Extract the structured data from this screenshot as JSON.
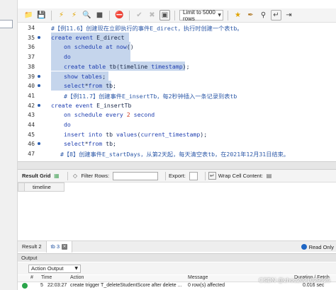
{
  "toolbar": {
    "limit_select": "Limit to 5000 rows",
    "icons": [
      "folder-icon",
      "save-icon",
      "bolt-icon",
      "bolt-cursor-icon",
      "magnify-icon",
      "stop-icon",
      "refresh-icon",
      "no-entry-icon",
      "check-circle-icon",
      "cancel-circle-icon",
      "toggle-output-icon",
      "star-icon",
      "brush-icon",
      "search-icon",
      "wrap-icon",
      "indent-icon"
    ]
  },
  "editor": {
    "lines": [
      {
        "num": "34",
        "dot": false,
        "selected": false,
        "indent": 1,
        "text": "#【例11.6】创建现在立即执行的事件E_direct，执行时创建一个表tb。"
      },
      {
        "num": "35",
        "dot": true,
        "selected": true,
        "indent": 1,
        "text": "create event E_direct"
      },
      {
        "num": "36",
        "dot": false,
        "selected": true,
        "indent": 3,
        "text": "on schedule at now()"
      },
      {
        "num": "37",
        "dot": false,
        "selected": true,
        "indent": 3,
        "text": "do"
      },
      {
        "num": "38",
        "dot": false,
        "selected": true,
        "indent": 3,
        "text": "create table tb(timeline timestamp);"
      },
      {
        "num": "39",
        "dot": true,
        "selected": true,
        "indent": 3,
        "text": "show tables;"
      },
      {
        "num": "40",
        "dot": true,
        "selected": true,
        "indent": 3,
        "text": "select*from tb;"
      },
      {
        "num": "41",
        "dot": false,
        "selected": false,
        "indent": 3,
        "text": "#【例11.7】创建事件E_insertTb，每2秒钟插入一条记录到表tb"
      },
      {
        "num": "42",
        "dot": true,
        "selected": false,
        "indent": 1,
        "text": "create event E_insertTb"
      },
      {
        "num": "43",
        "dot": false,
        "selected": false,
        "indent": 3,
        "text": "on schedule every 2 second"
      },
      {
        "num": "44",
        "dot": false,
        "selected": false,
        "indent": 3,
        "text": "do"
      },
      {
        "num": "45",
        "dot": false,
        "selected": false,
        "indent": 3,
        "text": "insert into tb values(current_timestamp);"
      },
      {
        "num": "46",
        "dot": true,
        "selected": false,
        "indent": 3,
        "text": "select*from tb;"
      },
      {
        "num": "47",
        "dot": false,
        "selected": false,
        "indent": 2,
        "text": "#【8】创建事件E_startDays，从第2天起，每天清空表tb，在2021年12月31日结束。"
      }
    ]
  },
  "result_toolbar": {
    "result_grid": "Result Grid",
    "filter_rows": "Filter Rows:",
    "export": "Export:",
    "wrap_cell": "Wrap Cell Content:"
  },
  "grid": {
    "columns": [
      "timeline"
    ]
  },
  "tabs": {
    "items": [
      "Result 2",
      "tb 3"
    ],
    "active": "tb 3",
    "read_only": "Read Only"
  },
  "output": {
    "title": "Output",
    "action_select": "Action Output",
    "headers": {
      "index": "#",
      "time": "Time",
      "action": "Action",
      "message": "Message",
      "duration": "Duration / Fetch"
    },
    "row": {
      "index": "5",
      "time": "22:03:27",
      "action": "create trigger T_deleteStudentScore after delete ...",
      "message": "0 row(s) affected",
      "duration": "0.016 sec"
    }
  },
  "watermark": "CSDN @zhou2021029525",
  "colors": {
    "keyword": "#1f3fb0",
    "comment": "#2e5aa8",
    "number": "#d23a1f",
    "selection": "#c5d5ec"
  }
}
